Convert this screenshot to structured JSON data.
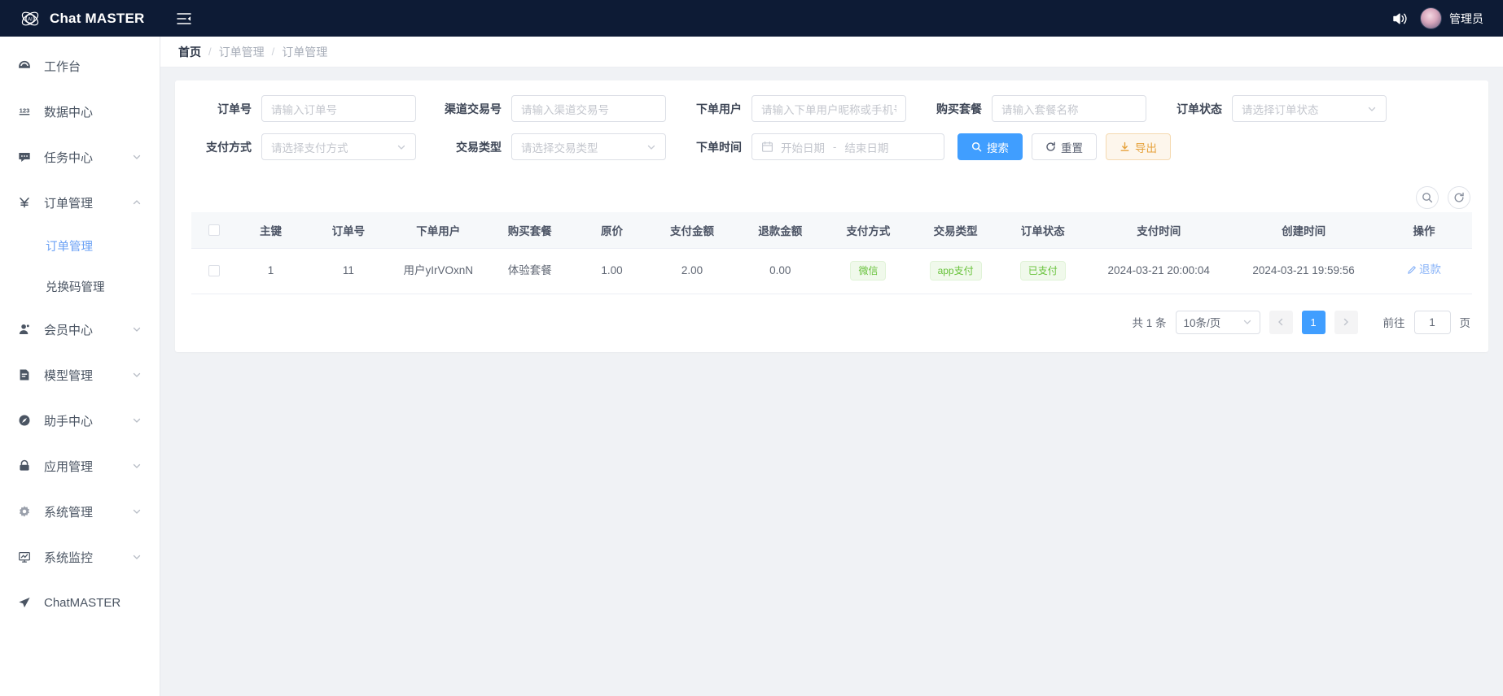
{
  "topbar": {
    "brand": "Chat MASTER",
    "logo_icon": "ai-atom-logo-icon",
    "collapse_icon": "menu-collapse-icon",
    "sound_icon": "sound-on-icon",
    "avatar_icon": "user-avatar",
    "user_name": "管理员"
  },
  "sidebar": {
    "items": [
      {
        "label": "工作台",
        "icon": "dashboard-icon",
        "expandable": false,
        "state": ""
      },
      {
        "label": "数据中心",
        "icon": "numbers-123-icon",
        "expandable": false,
        "state": ""
      },
      {
        "label": "任务中心",
        "icon": "chat-bubble-icon",
        "expandable": true,
        "state": "collapsed"
      },
      {
        "label": "订单管理",
        "icon": "yuan-currency-icon",
        "expandable": true,
        "state": "expanded"
      }
    ],
    "sub_items": [
      {
        "label": "订单管理",
        "active": true
      },
      {
        "label": "兑换码管理",
        "active": false
      }
    ],
    "items_after": [
      {
        "label": "会员中心",
        "icon": "user-member-icon",
        "expandable": true,
        "state": "collapsed"
      },
      {
        "label": "模型管理",
        "icon": "document-icon",
        "expandable": true,
        "state": "collapsed"
      },
      {
        "label": "助手中心",
        "icon": "compass-icon",
        "expandable": true,
        "state": "collapsed"
      },
      {
        "label": "应用管理",
        "icon": "lock-icon",
        "expandable": true,
        "state": "collapsed"
      },
      {
        "label": "系统管理",
        "icon": "gear-icon",
        "expandable": true,
        "state": "collapsed"
      },
      {
        "label": "系统监控",
        "icon": "monitor-chart-icon",
        "expandable": true,
        "state": "collapsed"
      },
      {
        "label": "ChatMASTER",
        "icon": "send-plane-icon",
        "expandable": false,
        "state": ""
      }
    ]
  },
  "breadcrumb": [
    {
      "label": "首页"
    },
    {
      "label": "订单管理"
    },
    {
      "label": "订单管理"
    }
  ],
  "breadcrumb_sep": "/",
  "filter": {
    "row1": [
      {
        "label": "订单号",
        "placeholder": "请输入订单号",
        "type": "input"
      },
      {
        "label": "渠道交易号",
        "placeholder": "请输入渠道交易号",
        "type": "input"
      },
      {
        "label": "下单用户",
        "placeholder": "请输入下单用户昵称或手机号",
        "type": "input"
      },
      {
        "label": "购买套餐",
        "placeholder": "请输入套餐名称",
        "type": "input"
      },
      {
        "label": "订单状态",
        "placeholder": "请选择订单状态",
        "type": "select"
      }
    ],
    "row2": [
      {
        "label": "支付方式",
        "placeholder": "请选择支付方式",
        "type": "select"
      },
      {
        "label": "交易类型",
        "placeholder": "请选择交易类型",
        "type": "select"
      }
    ],
    "daterange": {
      "label": "下单时间",
      "icon": "calendar-icon",
      "start_placeholder": "开始日期",
      "separator": "-",
      "end_placeholder": "结束日期"
    },
    "buttons": [
      {
        "label": "搜索",
        "icon": "search-icon",
        "style": "primary"
      },
      {
        "label": "重置",
        "icon": "refresh-icon",
        "style": "default"
      },
      {
        "label": "导出",
        "icon": "download-icon",
        "style": "warning"
      }
    ]
  },
  "table_tools": [
    {
      "icon": "search-toggle-icon"
    },
    {
      "icon": "refresh-table-icon"
    }
  ],
  "table": {
    "columns": [
      "",
      "主键",
      "订单号",
      "下单用户",
      "购买套餐",
      "原价",
      "支付金额",
      "退款金额",
      "支付方式",
      "交易类型",
      "订单状态",
      "支付时间",
      "创建时间",
      "操作"
    ],
    "rows": [
      {
        "checked": false,
        "id": "1",
        "order_no": "11",
        "user": "用户yIrVOxnN",
        "package": "体验套餐",
        "original_price": "1.00",
        "paid_amount": "2.00",
        "refund_amount": "0.00",
        "pay_method": "微信",
        "trade_type": "app支付",
        "order_status": "已支付",
        "pay_time": "2024-03-21 20:00:04",
        "create_time": "2024-03-21 19:59:56",
        "action": "退款",
        "action_icon": "refund-edit-icon"
      }
    ]
  },
  "pagination": {
    "total_text": "共 1 条",
    "page_size": "10条/页",
    "prev_icon": "chevron-left-icon",
    "next_icon": "chevron-right-icon",
    "pages": [
      "1"
    ],
    "current_page": "1",
    "goto_label": "前往",
    "goto_value": "1",
    "goto_suffix": "页"
  },
  "colors": {
    "topbar_bg": "#0d1b35",
    "primary": "#409eff",
    "warning_bg": "#fdf6ec",
    "warning_text": "#e6a23c",
    "success_tag_bg": "#f0f9eb",
    "success_tag_text": "#67c23a",
    "active_nav": "#6ba1f5",
    "page_bg": "#f0f2f5"
  }
}
